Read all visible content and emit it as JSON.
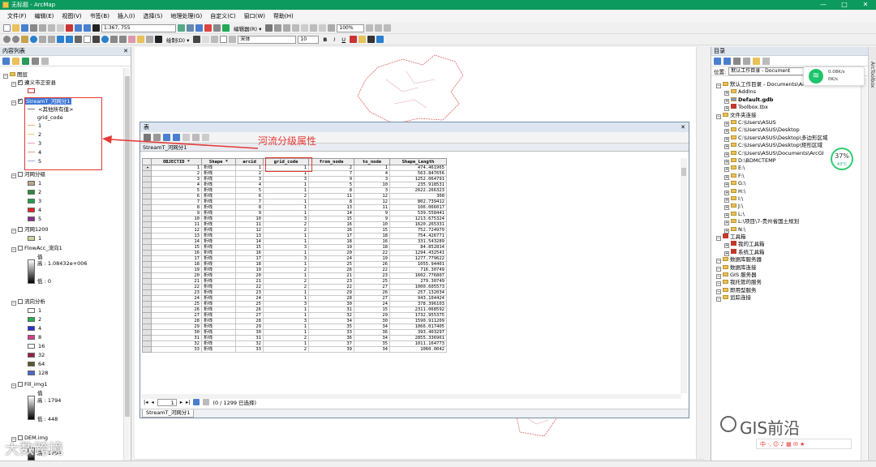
{
  "window": {
    "title": "无标题 - ArcMap",
    "btn_min": "—",
    "btn_max": "□",
    "btn_close": "✕"
  },
  "menu": [
    "文件(F)",
    "编辑(E)",
    "视图(V)",
    "书签(B)",
    "插入(I)",
    "选择(S)",
    "地理处理(G)",
    "自定义(C)",
    "窗口(W)",
    "帮助(H)"
  ],
  "toolbar": {
    "scale": "1:367, 755",
    "editor": "编辑器(R) ▾",
    "zoom": "100%",
    "draw": "绘制(D) ▾",
    "font": "宋体",
    "font_size": "10",
    "bold": "B",
    "italic": "I",
    "underline": "U"
  },
  "toc": {
    "title": "内容列表",
    "close": "✕",
    "root": "图层",
    "layers": [
      {
        "label": "遵义市正安县",
        "checked": true
      },
      {
        "label": "StreamT_河网分1",
        "checked": true,
        "selected": true
      },
      {
        "label": "河网分级",
        "checked": false
      },
      {
        "label": "河网1200",
        "checked": false
      },
      {
        "label": "FlowAcc_流向1",
        "checked": false
      },
      {
        "label": "流向分析",
        "checked": false
      },
      {
        "label": "Fill_img1",
        "checked": false
      },
      {
        "label": "DEM.img",
        "checked": false
      }
    ],
    "stream_legend": {
      "other": "<其他所有值>",
      "field": "grid_code",
      "values": [
        "1",
        "2",
        "3",
        "4",
        "5"
      ]
    },
    "grading_legend": [
      {
        "label": "1",
        "color": "#b7a88d"
      },
      {
        "label": "2",
        "color": "#2e8b3a"
      },
      {
        "label": "3",
        "color": "#1ea34a"
      },
      {
        "label": "4",
        "color": "#e02424"
      },
      {
        "label": "5",
        "color": "#8b2b8f"
      }
    ],
    "river1200_value": "1",
    "flowacc": {
      "value_label": "值",
      "high": "高 : 1.08432e+006",
      "low": "低 : 0"
    },
    "flowdir_legend": [
      {
        "label": "1",
        "color": "#ffffff"
      },
      {
        "label": "2",
        "color": "#21b24b"
      },
      {
        "label": "4",
        "color": "#2b2bd6"
      },
      {
        "label": "8",
        "color": "#d93b8e"
      },
      {
        "label": "16",
        "color": "#ffffff"
      },
      {
        "label": "32",
        "color": "#9c1c4a"
      },
      {
        "label": "64",
        "color": "#5a5a2a"
      },
      {
        "label": "128",
        "color": "#4a68c8"
      }
    ],
    "fill": {
      "value_label": "值",
      "high": "高 : 1794",
      "low": "低 : 448"
    },
    "dem": {
      "high": "高 : 1794"
    }
  },
  "callout": "河流分级属性",
  "attr": {
    "title": "表",
    "close": "✕",
    "tab": "StreamT_河网分1",
    "columns": [
      "OBJECTID *",
      "Shape *",
      "arcid",
      "grid_code",
      "from_node",
      "to_node",
      "Shape_Length"
    ],
    "rows": [
      [
        "1",
        "折线",
        "1",
        "1",
        "2",
        "1",
        "474.461965"
      ],
      [
        "2",
        "折线",
        "2",
        "1",
        "7",
        "4",
        "563.847656"
      ],
      [
        "3",
        "折线",
        "3",
        "3",
        "9",
        "3",
        "1252.064791"
      ],
      [
        "4",
        "折线",
        "4",
        "1",
        "5",
        "10",
        "235.918531"
      ],
      [
        "5",
        "折线",
        "5",
        "1",
        "8",
        "3",
        "2622.266323"
      ],
      [
        "6",
        "折线",
        "6",
        "2",
        "11",
        "12",
        "300"
      ],
      [
        "7",
        "折线",
        "7",
        "1",
        "8",
        "12",
        "802.739412"
      ],
      [
        "8",
        "折线",
        "8",
        "1",
        "13",
        "11",
        "106.066017"
      ],
      [
        "9",
        "折线",
        "9",
        "1",
        "14",
        "9",
        "539.558441"
      ],
      [
        "10",
        "折线",
        "10",
        "3",
        "15",
        "9",
        "1213.675324"
      ],
      [
        "11",
        "折线",
        "11",
        "2",
        "16",
        "10",
        "1620.265331"
      ],
      [
        "12",
        "折线",
        "12",
        "2",
        "16",
        "15",
        "752.724979"
      ],
      [
        "13",
        "折线",
        "13",
        "1",
        "17",
        "18",
        "754.426771"
      ],
      [
        "14",
        "折线",
        "14",
        "1",
        "18",
        "16",
        "331.543289"
      ],
      [
        "15",
        "折线",
        "15",
        "3",
        "19",
        "18",
        "84.852814"
      ],
      [
        "16",
        "折线",
        "16",
        "1",
        "20",
        "22",
        "1294.432541"
      ],
      [
        "17",
        "折线",
        "17",
        "3",
        "24",
        "19",
        "1277.779622"
      ],
      [
        "18",
        "折线",
        "18",
        "1",
        "25",
        "26",
        "1055.94401"
      ],
      [
        "19",
        "折线",
        "19",
        "2",
        "26",
        "22",
        "716.30749"
      ],
      [
        "20",
        "折线",
        "20",
        "1",
        "21",
        "23",
        "1602.776807"
      ],
      [
        "21",
        "折线",
        "21",
        "2",
        "23",
        "25",
        "279.30749"
      ],
      [
        "22",
        "折线",
        "22",
        "2",
        "22",
        "27",
        "1000.605573"
      ],
      [
        "23",
        "折线",
        "23",
        "1",
        "29",
        "26",
        "257.132034"
      ],
      [
        "24",
        "折线",
        "24",
        "1",
        "28",
        "27",
        "943.104424"
      ],
      [
        "25",
        "折线",
        "25",
        "3",
        "30",
        "24",
        "378.396103"
      ],
      [
        "26",
        "折线",
        "26",
        "1",
        "31",
        "15",
        "2311.068592"
      ],
      [
        "27",
        "折线",
        "27",
        "1",
        "32",
        "29",
        "1732.955375"
      ],
      [
        "28",
        "折线",
        "28",
        "3",
        "34",
        "30",
        "1590.911209"
      ],
      [
        "29",
        "折线",
        "29",
        "1",
        "35",
        "34",
        "1066.017405"
      ],
      [
        "30",
        "折线",
        "30",
        "1",
        "33",
        "36",
        "393.403297"
      ],
      [
        "31",
        "折线",
        "31",
        "2",
        "36",
        "34",
        "2855.336961"
      ],
      [
        "32",
        "折线",
        "32",
        "1",
        "37",
        "35",
        "1011.164773"
      ],
      [
        "33",
        "折线",
        "33",
        "2",
        "39",
        "34",
        "1060.0042"
      ]
    ],
    "nav_record": "1",
    "selection_status": "(0 / 1299 已选择)",
    "bottom_tab": "StreamT_河网分1"
  },
  "catalog": {
    "title": "目录",
    "location_label": "位置:",
    "location_value": "默认工作目录 - Document",
    "tree": [
      {
        "label": "默认工作目录 - Documents\\ArcG",
        "indent": 0,
        "type": "folder"
      },
      {
        "label": "AddIns",
        "indent": 1,
        "type": "folder"
      },
      {
        "label": "Default.gdb",
        "indent": 1,
        "type": "gdb",
        "bold": true
      },
      {
        "label": "Toolbox.tbx",
        "indent": 1,
        "type": "toolbox"
      },
      {
        "label": "文件夹连接",
        "indent": 0,
        "type": "folder"
      },
      {
        "label": "C:\\Users\\ASUS",
        "indent": 1,
        "type": "folder"
      },
      {
        "label": "C:\\Users\\ASUS\\Desktop",
        "indent": 1,
        "type": "folder"
      },
      {
        "label": "C:\\Users\\ASUS\\Desktop\\多边形区域",
        "indent": 1,
        "type": "folder"
      },
      {
        "label": "C:\\Users\\ASUS\\Desktop\\矩形区域",
        "indent": 1,
        "type": "folder"
      },
      {
        "label": "C:\\Users\\ASUS\\Documents\\ArcGI",
        "indent": 1,
        "type": "folder"
      },
      {
        "label": "D:\\BDMCTEMP",
        "indent": 1,
        "type": "folder"
      },
      {
        "label": "E:\\",
        "indent": 1,
        "type": "folder"
      },
      {
        "label": "F:\\",
        "indent": 1,
        "type": "folder"
      },
      {
        "label": "G:\\",
        "indent": 1,
        "type": "folder"
      },
      {
        "label": "H:\\",
        "indent": 1,
        "type": "folder"
      },
      {
        "label": "I:\\",
        "indent": 1,
        "type": "folder"
      },
      {
        "label": "J:\\",
        "indent": 1,
        "type": "folder"
      },
      {
        "label": "L:\\",
        "indent": 1,
        "type": "folder"
      },
      {
        "label": "L:\\项目\\7-贵州省国土规划",
        "indent": 1,
        "type": "folder"
      },
      {
        "label": "N:\\",
        "indent": 1,
        "type": "folder"
      },
      {
        "label": "工具箱",
        "indent": 0,
        "type": "toolbox"
      },
      {
        "label": "我的工具箱",
        "indent": 1,
        "type": "toolbox"
      },
      {
        "label": "系统工具箱",
        "indent": 1,
        "type": "toolbox"
      },
      {
        "label": "数据库服务器",
        "indent": 0,
        "type": "folder"
      },
      {
        "label": "数据库连接",
        "indent": 0,
        "type": "folder"
      },
      {
        "label": "GIS 服务器",
        "indent": 0,
        "type": "folder"
      },
      {
        "label": "我托管的服务",
        "indent": 0,
        "type": "folder"
      },
      {
        "label": "即用型服务",
        "indent": 0,
        "type": "folder"
      },
      {
        "label": "追踪连接",
        "indent": 0,
        "type": "folder"
      }
    ]
  },
  "side_strip": "ArcToolbox",
  "overlay": {
    "net_up": "0.08K/s",
    "net_down": "0K/s",
    "cpu": "37%",
    "cpu_temp": "43°C"
  },
  "watermarks": {
    "left": "大数跨境",
    "right": "GIS前沿",
    "ime": "中 ·, ☺ ♪ ▦ ✉ ★"
  },
  "colors": {
    "title_green": "#0c9a5e",
    "highlight_red": "#e53935",
    "selection_blue": "#3a78d6"
  }
}
